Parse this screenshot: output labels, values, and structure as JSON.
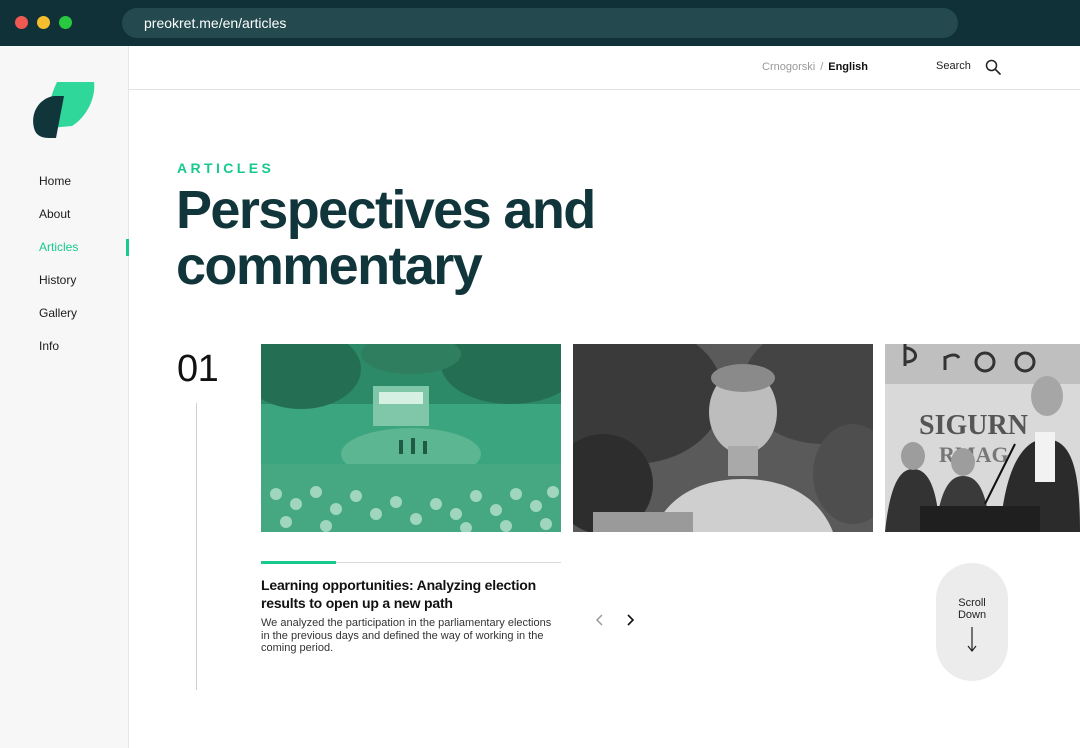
{
  "browser": {
    "url": "preokret.me/en/articles"
  },
  "sidebar": {
    "items": [
      {
        "label": "Home",
        "active": false
      },
      {
        "label": "About",
        "active": false
      },
      {
        "label": "Articles",
        "active": true
      },
      {
        "label": "History",
        "active": false
      },
      {
        "label": "Gallery",
        "active": false
      },
      {
        "label": "Info",
        "active": false
      }
    ]
  },
  "topbar": {
    "lang_me": "Crnogorski",
    "lang_sep": "/",
    "lang_en": "English",
    "search_label": "Search"
  },
  "hero": {
    "eyebrow": "ARTICLES",
    "title_line1": "Perspectives and",
    "title_line2": "commentary"
  },
  "carousel": {
    "counter": "01",
    "progress": 0.25,
    "article_title": "Learning opportunities: Analyzing election results to open up a new path",
    "article_desc": "We analyzed the participation in the parliamentary elections in the previous days and defined the way of working in the coming period.",
    "card3_sign_text": "SIGURN",
    "card3_sign_text2": "RMAG"
  },
  "scroll": {
    "line1": "Scroll",
    "line2": "Down"
  },
  "colors": {
    "accent": "#17c98f",
    "dark": "#10353a"
  }
}
